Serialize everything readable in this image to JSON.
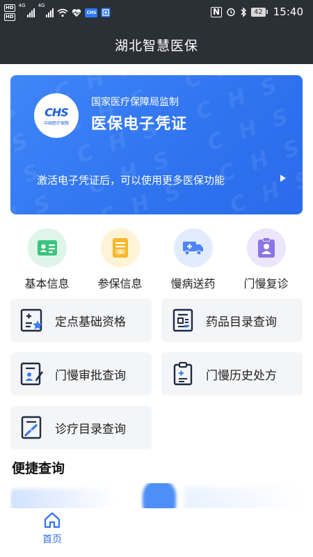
{
  "status_bar": {
    "hd_badge_1": "HD",
    "hd_badge_2": "HD",
    "network_1": "4G",
    "network_2": "4G",
    "app_badge": "CHS",
    "battery": "42",
    "time": "15:40"
  },
  "header": {
    "title": "湖北智慧医保"
  },
  "card": {
    "subtitle": "国家医疗保障局监制",
    "title": "医保电子凭证",
    "logo_text": "CHS",
    "logo_caption": "中国医疗保障",
    "hint": "激活电子凭证后，可以使用更多医保功能",
    "watermark": "CHS CHS CHS CHS CHS CHS",
    "colors": {
      "gradient_start": "#3f86f8",
      "gradient_end": "#2a6bea"
    }
  },
  "quick_actions": [
    {
      "label": "基本信息",
      "icon": "id-card-icon",
      "bg": "#dff5ea",
      "fg": "#34c07a"
    },
    {
      "label": "参保信息",
      "icon": "insurance-doc-icon",
      "bg": "#fff3d6",
      "fg": "#f4b728"
    },
    {
      "label": "慢病送药",
      "icon": "delivery-truck-icon",
      "bg": "#e3ecff",
      "fg": "#4f84f5"
    },
    {
      "label": "门慢复诊",
      "icon": "doctor-card-icon",
      "bg": "#ebe6fb",
      "fg": "#8a74e6"
    }
  ],
  "services": [
    {
      "label": "定点基础资格",
      "icon": "qualification-icon"
    },
    {
      "label": "药品目录查询",
      "icon": "drug-catalog-icon"
    },
    {
      "label": "门慢审批查询",
      "icon": "approval-query-icon"
    },
    {
      "label": "门慢历史处方",
      "icon": "prescription-history-icon"
    },
    {
      "label": "诊疗目录查询",
      "icon": "treatment-catalog-icon"
    }
  ],
  "section": {
    "title": "便捷查询"
  },
  "tabbar": {
    "home_label": "首页",
    "accent": "#2f73ef"
  }
}
